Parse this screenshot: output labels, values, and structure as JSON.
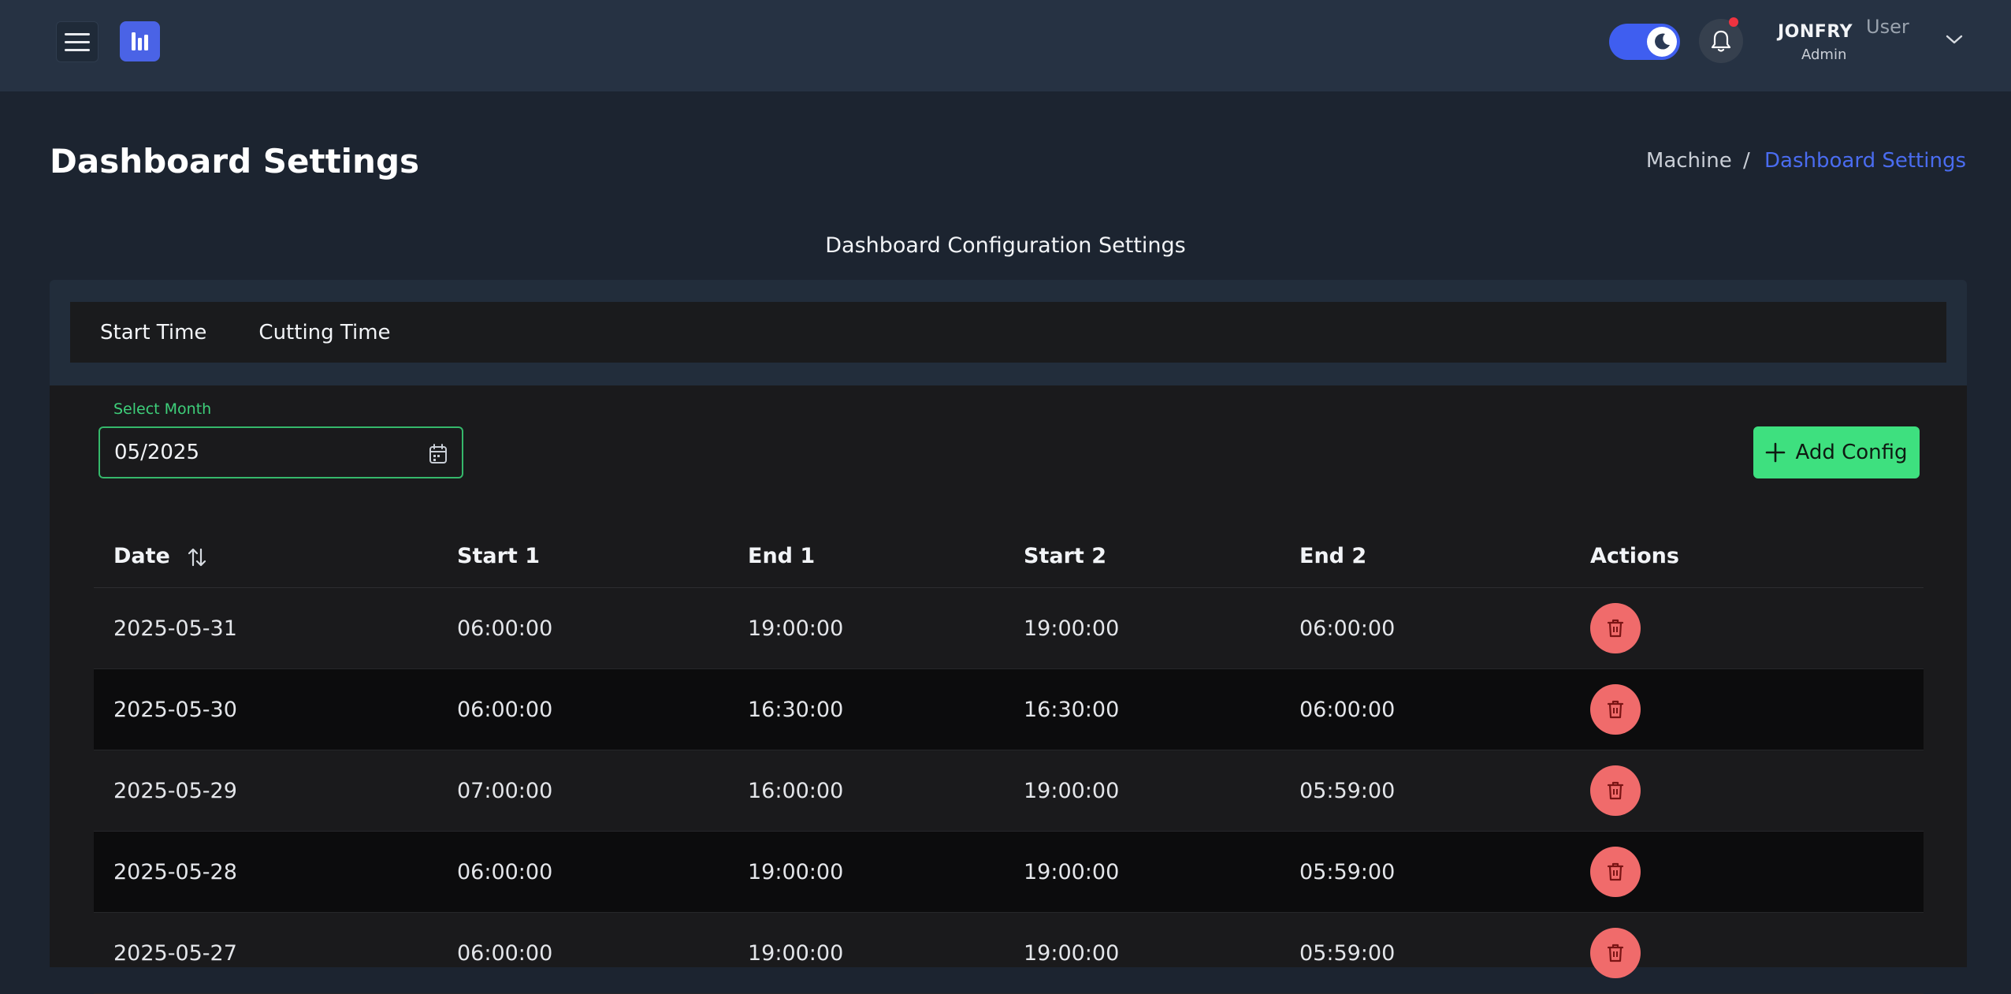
{
  "topbar": {
    "user_name": "JONFRY",
    "user_role": "Admin",
    "user_label": "User",
    "notification_dot_color": "#ef3340",
    "theme_toggle_color": "#3f5ef0"
  },
  "header": {
    "title": "Dashboard Settings",
    "breadcrumb_parent": "Machine",
    "breadcrumb_separator": "/",
    "breadcrumb_current": "Dashboard Settings",
    "breadcrumb_current_color": "#4a6cf0"
  },
  "section_title": "Dashboard Configuration Settings",
  "tabs": [
    {
      "label": "Start Time"
    },
    {
      "label": "Cutting Time"
    }
  ],
  "filter": {
    "label": "Select Month",
    "value": "05/2025",
    "accent_color": "#3ecf7a"
  },
  "add_button": {
    "label": "Add Config",
    "color": "#3ee07f"
  },
  "table": {
    "columns": [
      "Date",
      "Start 1",
      "End 1",
      "Start 2",
      "End 2",
      "Actions"
    ],
    "rows": [
      {
        "date": "2025-05-31",
        "start1": "06:00:00",
        "end1": "19:00:00",
        "start2": "19:00:00",
        "end2": "06:00:00"
      },
      {
        "date": "2025-05-30",
        "start1": "06:00:00",
        "end1": "16:30:00",
        "start2": "16:30:00",
        "end2": "06:00:00"
      },
      {
        "date": "2025-05-29",
        "start1": "07:00:00",
        "end1": "16:00:00",
        "start2": "19:00:00",
        "end2": "05:59:00"
      },
      {
        "date": "2025-05-28",
        "start1": "06:00:00",
        "end1": "19:00:00",
        "start2": "19:00:00",
        "end2": "05:59:00"
      },
      {
        "date": "2025-05-27",
        "start1": "06:00:00",
        "end1": "19:00:00",
        "start2": "19:00:00",
        "end2": "05:59:00"
      }
    ],
    "delete_color": "#f06b6b"
  },
  "icons": {
    "menu": "hamburger-icon",
    "logo": "bar-chart-logo-icon",
    "theme": "moon-icon",
    "notifications": "bell-icon",
    "user_menu": "chevron-down-icon",
    "month_picker": "calendar-icon",
    "add": "plus-icon",
    "sort": "sort-arrows-icon",
    "delete": "trash-icon"
  }
}
